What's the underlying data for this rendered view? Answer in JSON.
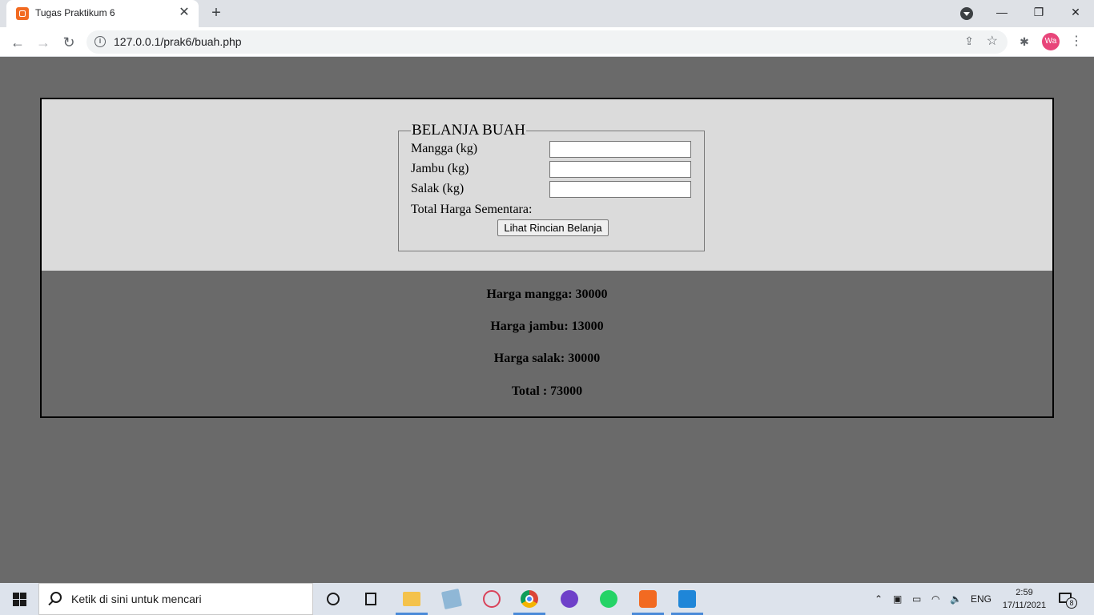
{
  "browser": {
    "tab_title": "Tugas Praktikum 6",
    "tab_close": "✕",
    "new_tab": "+",
    "url": "127.0.0.1/prak6/buah.php",
    "profile_initials": "Wa",
    "window_minimize": "—",
    "window_restore": "❐",
    "window_close": "✕"
  },
  "form": {
    "legend": "BELANJA BUAH",
    "fields": [
      {
        "label": "Mangga (kg)",
        "value": ""
      },
      {
        "label": "Jambu (kg)",
        "value": ""
      },
      {
        "label": "Salak (kg)",
        "value": ""
      }
    ],
    "total_label": "Total Harga Sementara:",
    "submit_label": "Lihat Rincian Belanja"
  },
  "results": {
    "mangga": "Harga mangga: 30000",
    "jambu": "Harga jambu: 13000",
    "salak": "Harga salak: 30000",
    "total": "Total : 73000"
  },
  "taskbar": {
    "search_placeholder": "Ketik di sini untuk mencari",
    "language": "ENG",
    "time": "2:59",
    "date": "17/11/2021",
    "notification_count": "8"
  },
  "colors": {
    "page_background": "#6a6a6a",
    "form_background": "#dbdbdb",
    "xampp_orange": "#f26a21",
    "taskbar_active": "#4a8ad8"
  }
}
